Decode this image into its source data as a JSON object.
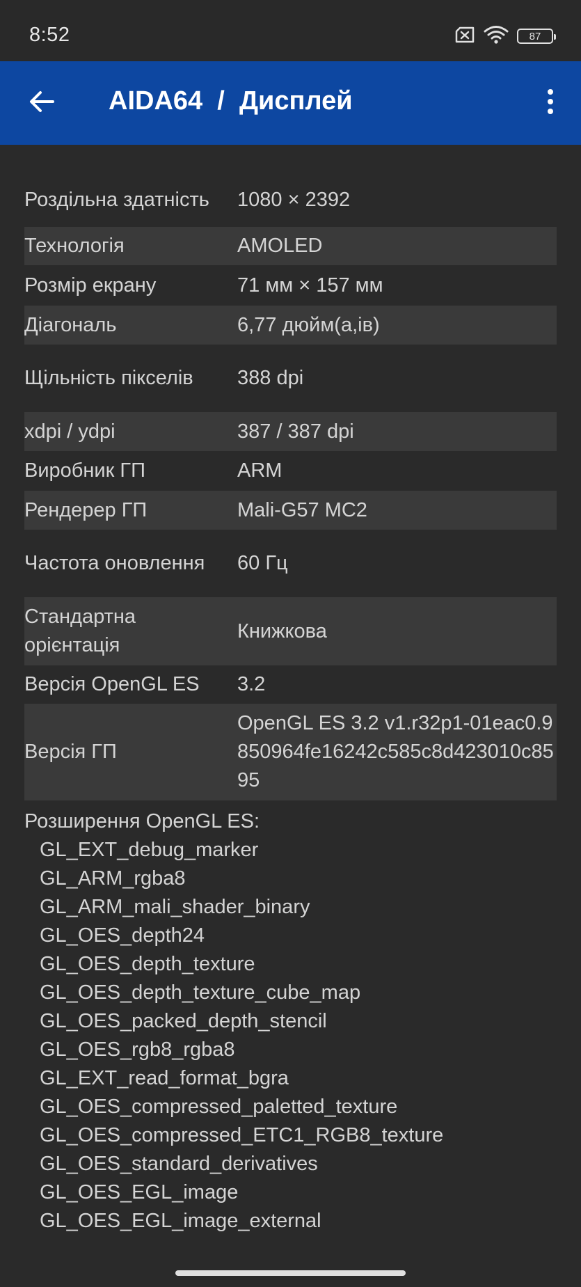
{
  "status_bar": {
    "time": "8:52",
    "icons": [
      "sim-error-icon",
      "wifi-icon",
      "battery-icon"
    ],
    "battery_level": "87"
  },
  "app_bar": {
    "title": "AIDA64  /  Дисплей",
    "back_icon": "arrow-left-icon",
    "menu_icon": "more-vert-icon",
    "background_color": "#0d47a1"
  },
  "rows": [
    {
      "label": "Роздільна здатність",
      "value": "1080 × 2392"
    },
    {
      "label": "Технологія",
      "value": "AMOLED"
    },
    {
      "label": "Розмір екрану",
      "value": "71 мм × 157 мм"
    },
    {
      "label": "Діагональ",
      "value": "6,77 дюйм(а,ів)"
    },
    {
      "label": "Щільність пікселів",
      "value": "388 dpi"
    },
    {
      "label": "xdpi / ydpi",
      "value": "387 / 387 dpi"
    },
    {
      "label": "Виробник ГП",
      "value": "ARM"
    },
    {
      "label": "Рендерер ГП",
      "value": "Mali-G57 MC2"
    },
    {
      "label": "Частота оновлення",
      "value": "60 Гц"
    },
    {
      "label": "Стандартна орієнтація",
      "value": "Книжкова"
    },
    {
      "label": "Версія OpenGL ES",
      "value": "3.2"
    },
    {
      "label": "Версія ГП",
      "value": "OpenGL ES 3.2 v1.r32p1-01eac0.9850964fe16242c585c8d423010c8595"
    }
  ],
  "extensions": {
    "header": "Розширення OpenGL ES:",
    "items": [
      "GL_EXT_debug_marker",
      "GL_ARM_rgba8",
      "GL_ARM_mali_shader_binary",
      "GL_OES_depth24",
      "GL_OES_depth_texture",
      "GL_OES_depth_texture_cube_map",
      "GL_OES_packed_depth_stencil",
      "GL_OES_rgb8_rgba8",
      "GL_EXT_read_format_bgra",
      "GL_OES_compressed_paletted_texture",
      "GL_OES_compressed_ETC1_RGB8_texture",
      "GL_OES_standard_derivatives",
      "GL_OES_EGL_image",
      "GL_OES_EGL_image_external"
    ]
  }
}
